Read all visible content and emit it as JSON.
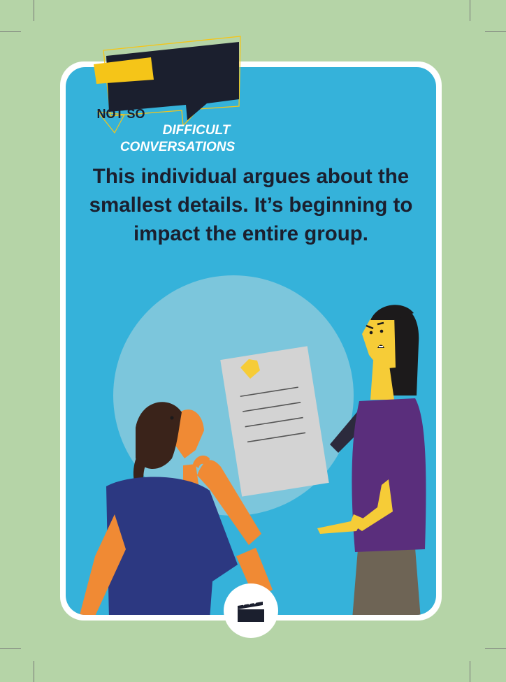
{
  "logo": {
    "line1": "NOT SO",
    "line2": "DIFFICULT",
    "line3": "CONVERSATIONS",
    "colors": {
      "dark": "#1b1f2e",
      "accent": "#f5c518"
    }
  },
  "question": "This individual argues about the smallest details. It’s beginning to impact the entire group.",
  "action": {
    "icon": "clapperboard-icon"
  },
  "colors": {
    "background": "#b5d4a7",
    "card": "#35b2da",
    "circle": "#7cc6dc",
    "text": "#1b1f2e"
  }
}
